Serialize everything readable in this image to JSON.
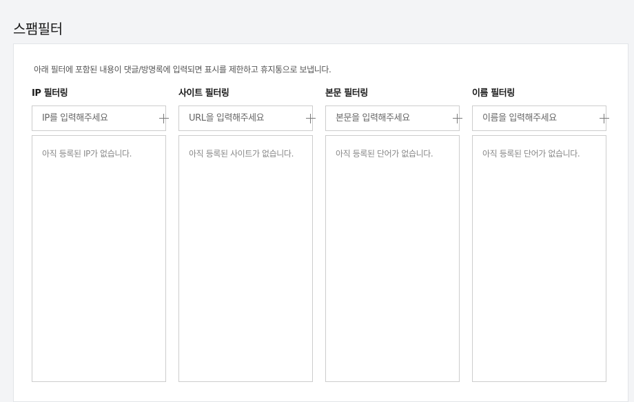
{
  "page": {
    "title": "스팸필터",
    "description": "아래 필터에 포함된 내용이 댓글/방명록에 입력되면 표시를 제한하고 휴지통으로 보냅니다."
  },
  "filters": [
    {
      "heading": "IP 필터링",
      "placeholder": "IP를 입력해주세요",
      "value": "",
      "add_icon": "plus-icon",
      "empty_text": "아직 등록된 IP가 없습니다."
    },
    {
      "heading": "사이트 필터링",
      "placeholder": "URL을 입력해주세요",
      "value": "",
      "add_icon": "plus-icon",
      "empty_text": "아직 등록된 사이트가 없습니다."
    },
    {
      "heading": "본문 필터링",
      "placeholder": "본문을 입력해주세요",
      "value": "",
      "add_icon": "plus-icon",
      "empty_text": "아직 등록된 단어가 없습니다."
    },
    {
      "heading": "이름 필터링",
      "placeholder": "이름을 입력해주세요",
      "value": "",
      "add_icon": "plus-icon",
      "empty_text": "아직 등록된 단어가 없습니다."
    }
  ],
  "colors": {
    "background": "#f3f4f6",
    "panel": "#ffffff",
    "border": "#cccccc",
    "muted_text": "#888888"
  }
}
